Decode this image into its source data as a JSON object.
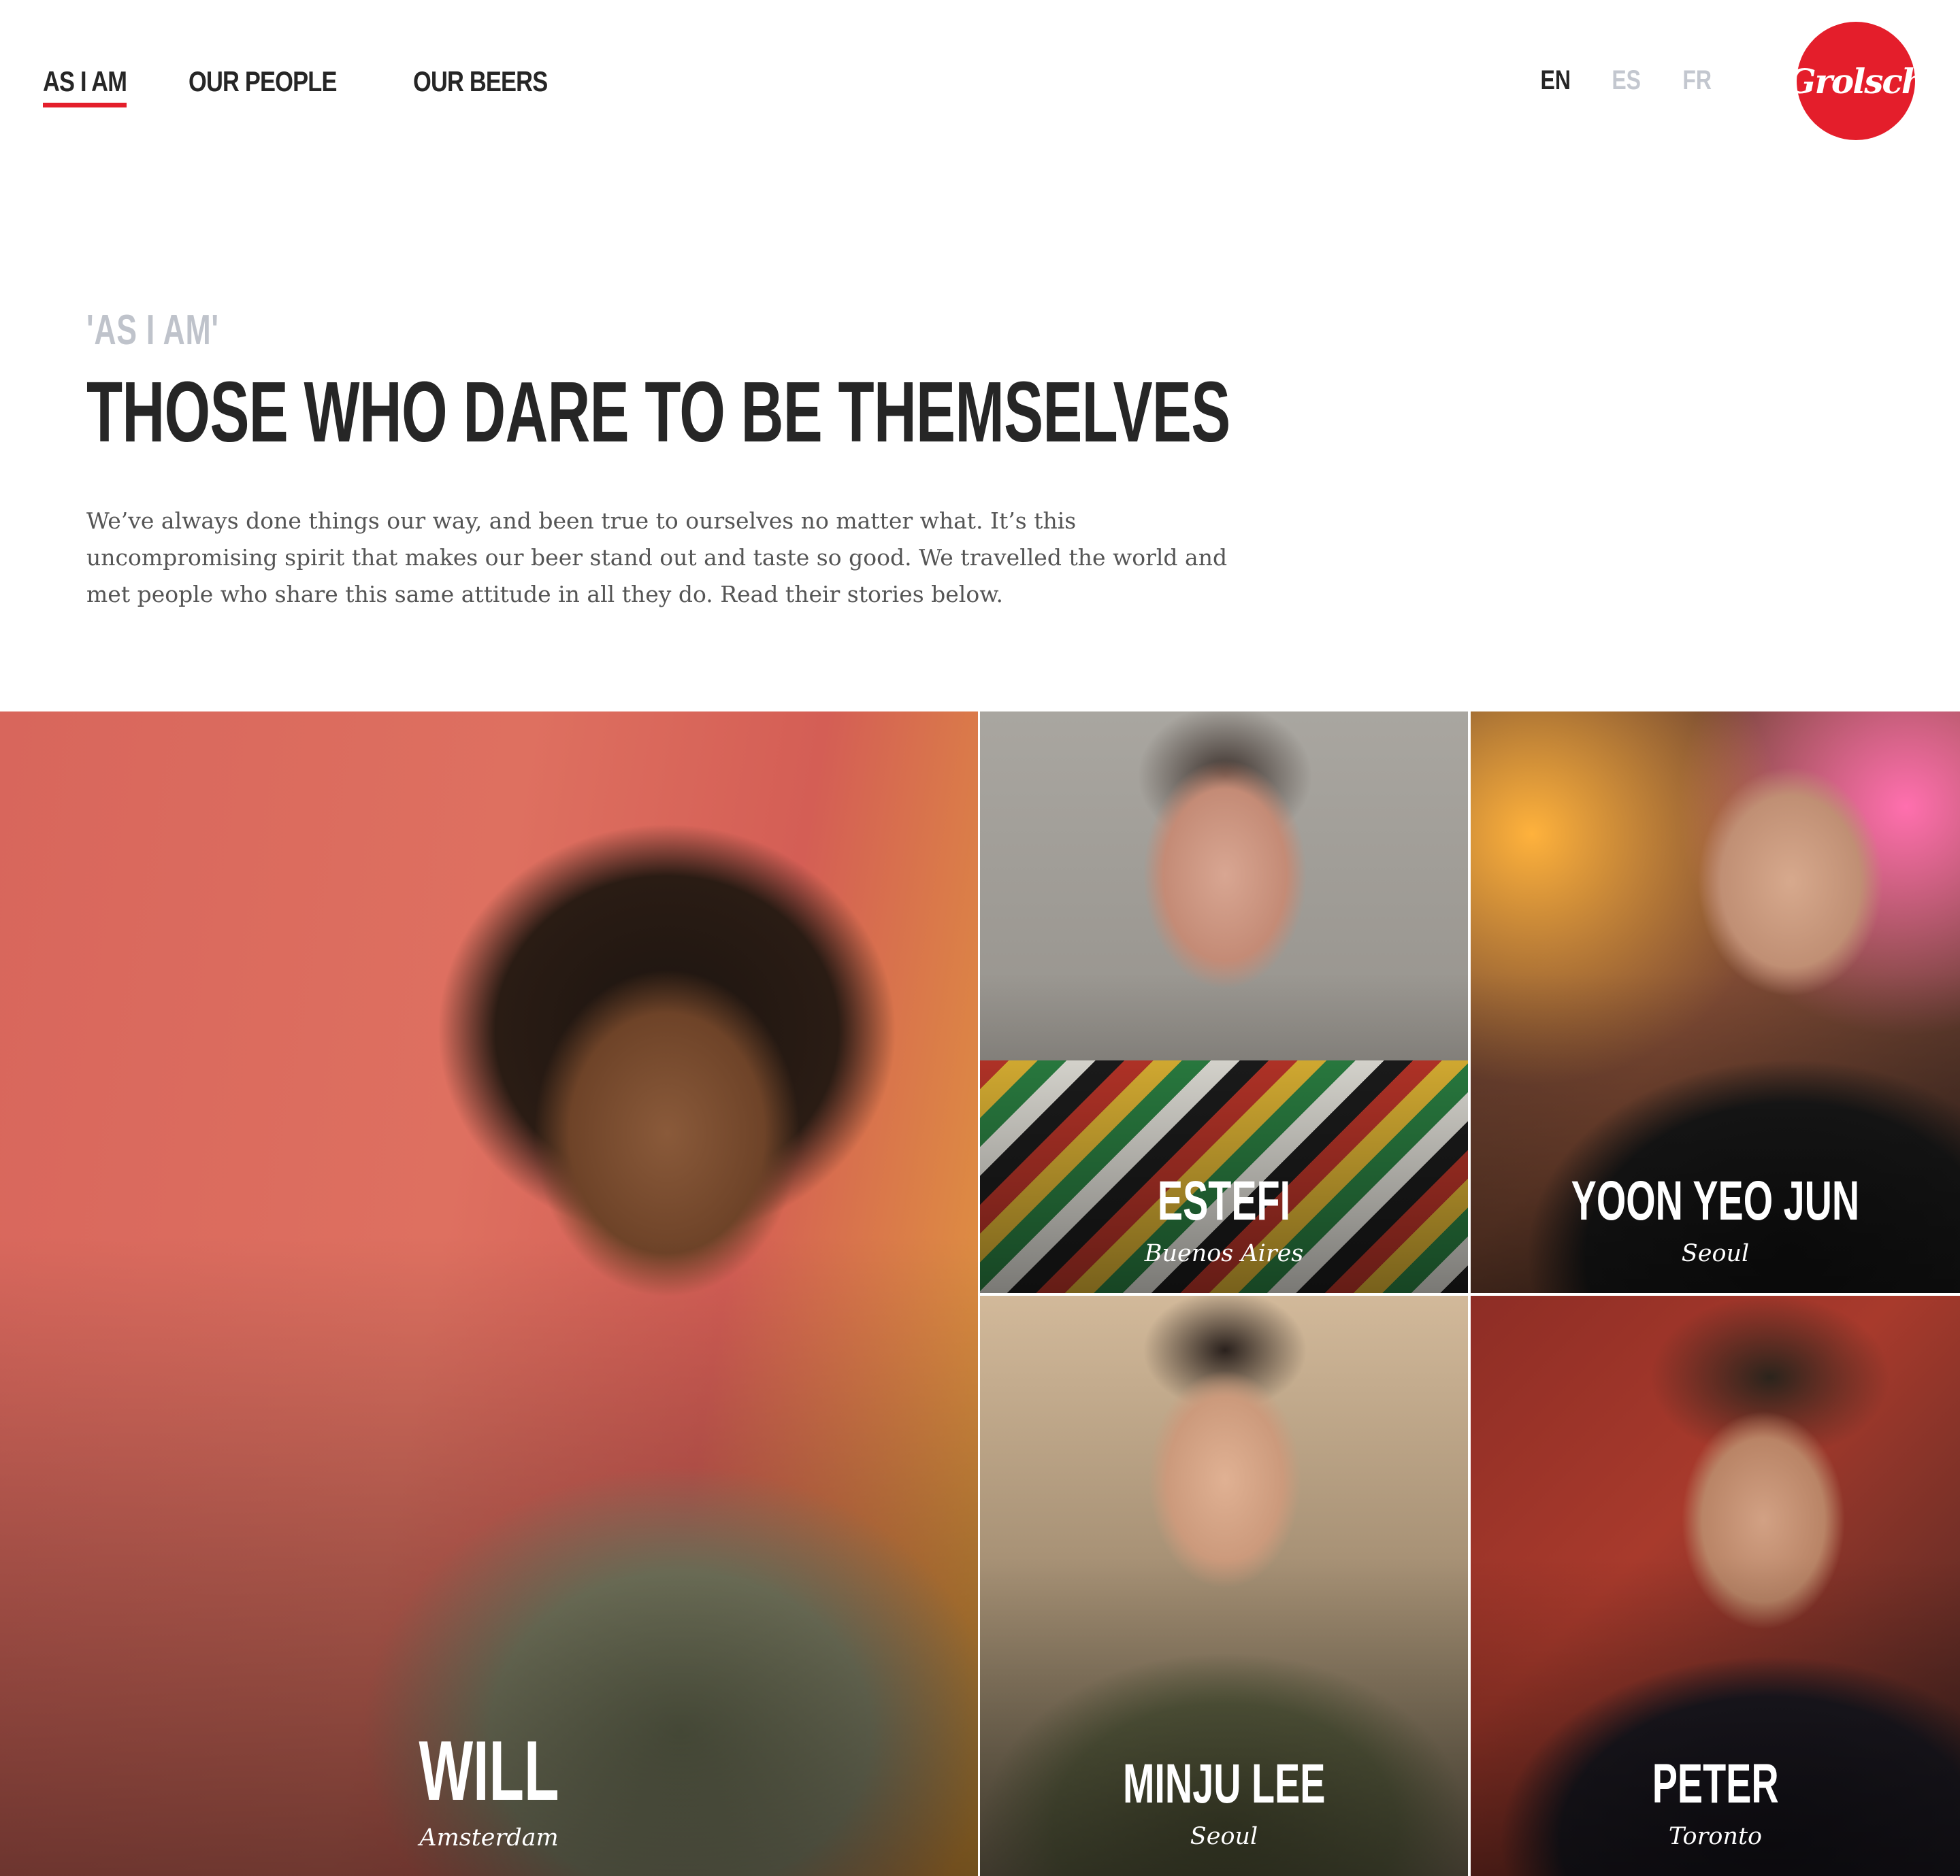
{
  "nav": {
    "items": [
      {
        "label": "AS I AM",
        "active": true
      },
      {
        "label": "OUR PEOPLE",
        "active": false
      },
      {
        "label": "OUR BEERS",
        "active": false
      }
    ]
  },
  "languages": [
    {
      "label": "EN",
      "active": true
    },
    {
      "label": "ES",
      "active": false
    },
    {
      "label": "FR",
      "active": false
    }
  ],
  "logo": {
    "text": "Grolsch",
    "color": "#e41e2b"
  },
  "intro": {
    "kicker": "'AS I AM'",
    "headline": "THOSE WHO DARE TO BE THEMSELVES",
    "body": "We’ve always done things our way, and been true to ourselves no matter what. It’s this uncompromising spirit that makes our beer stand out and taste so good. We travelled the world and met people who share this same attitude in all they do. Read their stories below."
  },
  "people": [
    {
      "name": "WILL",
      "city": "Amsterdam"
    },
    {
      "name": "ESTEFI",
      "city": "Buenos Aires"
    },
    {
      "name": "YOON YEO JUN",
      "city": "Seoul"
    },
    {
      "name": "MINJU LEE",
      "city": "Seoul"
    },
    {
      "name": "PETER",
      "city": "Toronto"
    }
  ],
  "colors": {
    "accent": "#e41e2b",
    "text": "#262626",
    "muted": "#c3c7cf"
  }
}
